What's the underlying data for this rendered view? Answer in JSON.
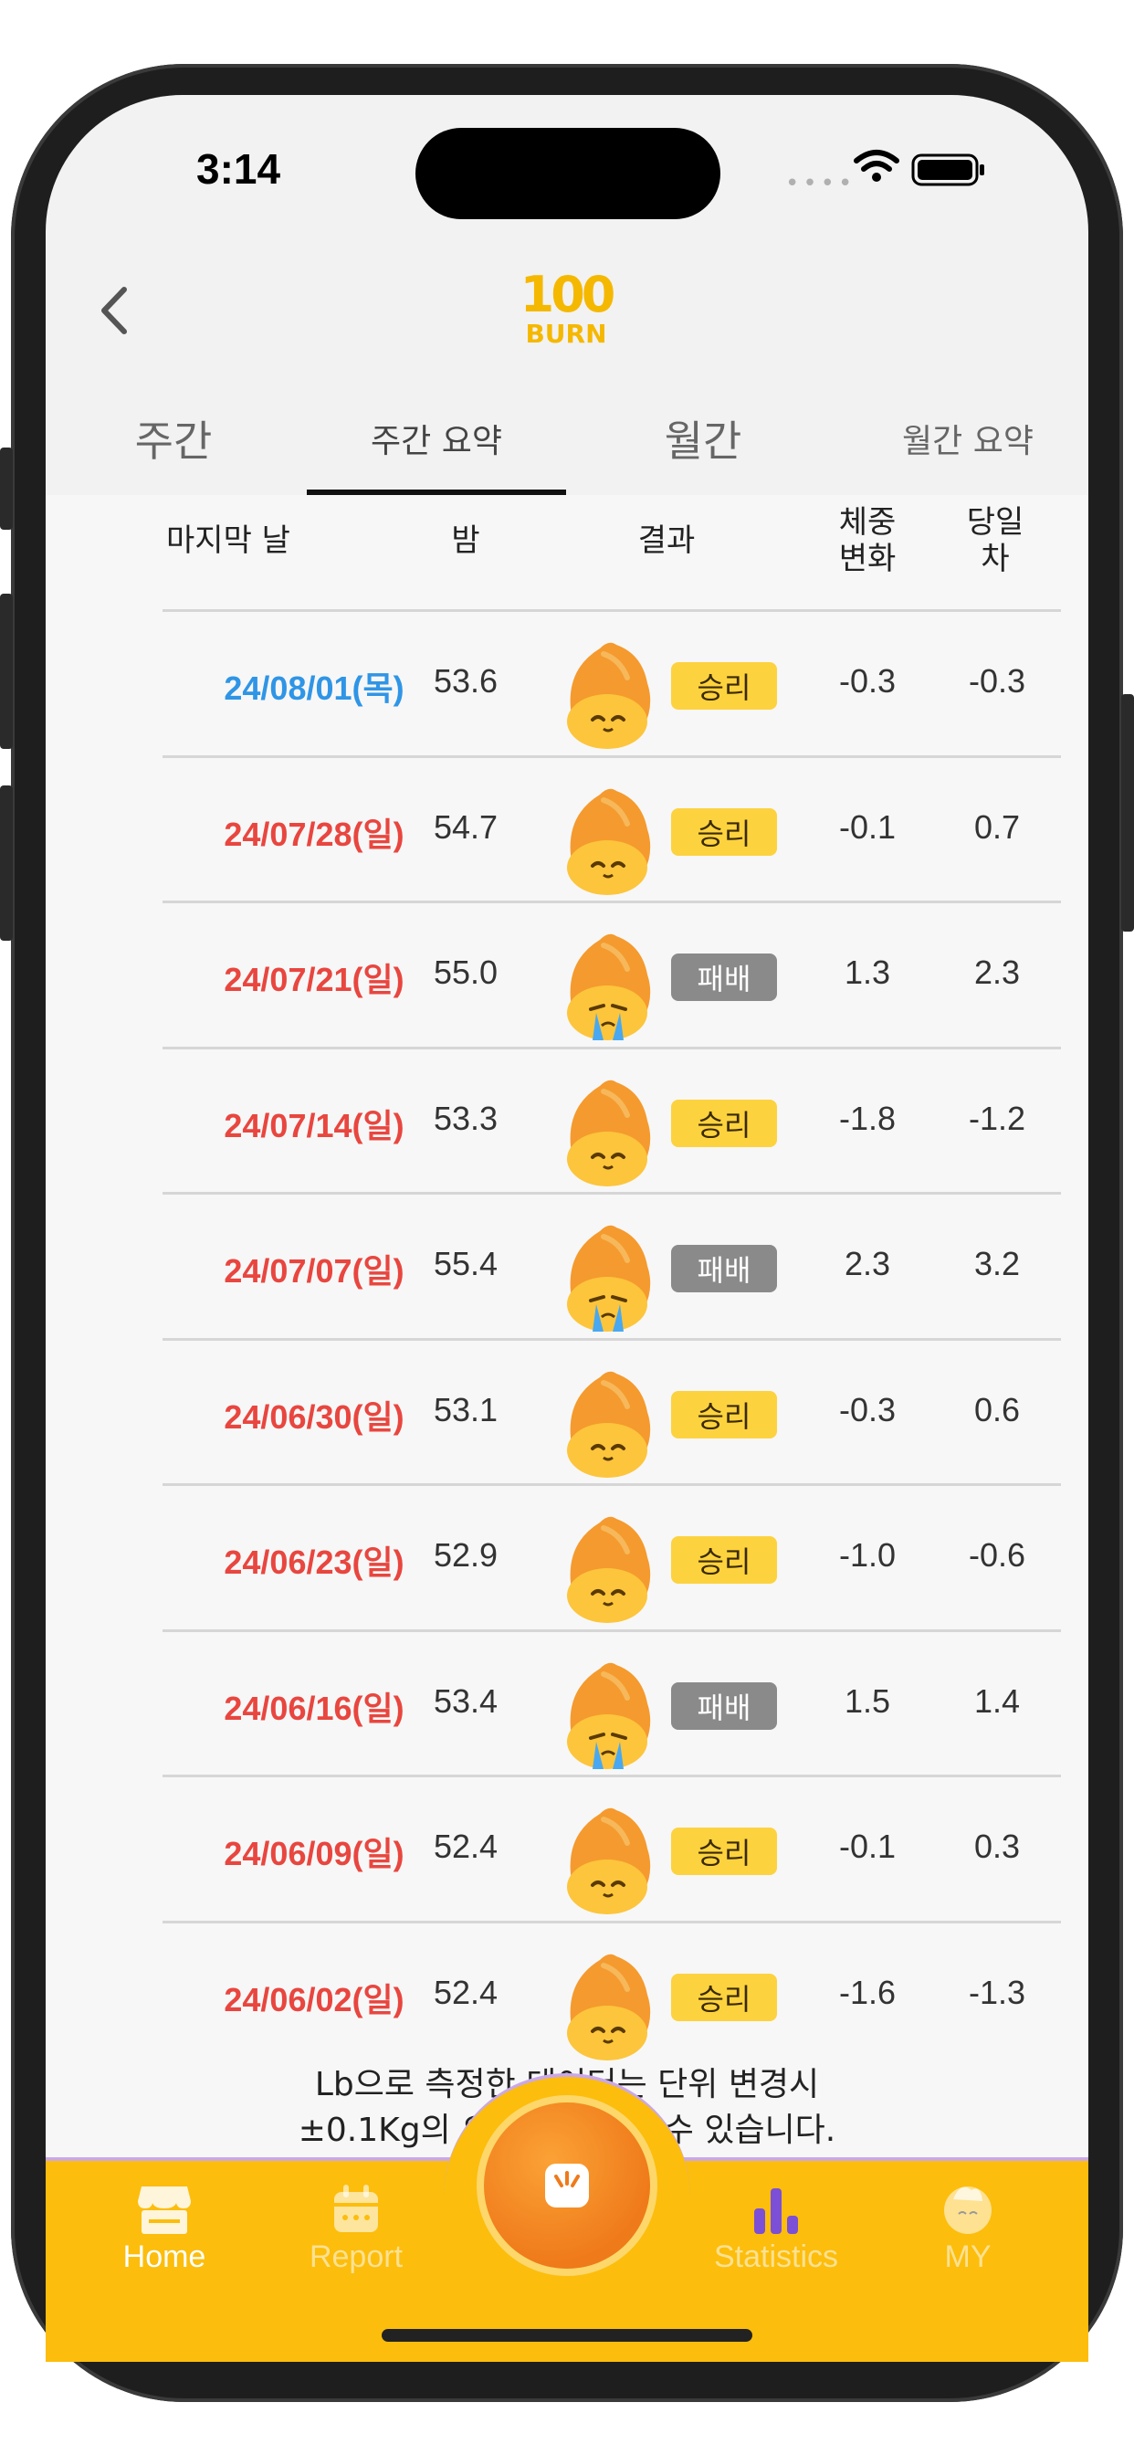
{
  "status_bar": {
    "time": "3:14",
    "dots": "••••"
  },
  "header": {
    "logo_number": "100",
    "logo_word": "BURN"
  },
  "tabs": [
    {
      "label": "주간",
      "active": false
    },
    {
      "label": "주간 요약",
      "active": true
    },
    {
      "label": "월간",
      "active": false
    },
    {
      "label": "월간 요약",
      "active": false
    }
  ],
  "table": {
    "headers": {
      "last_day": "마지막 날",
      "bam": "밤",
      "result": "결과",
      "weight_change_1": "체중",
      "weight_change_2": "변화",
      "day_diff_1": "당일",
      "day_diff_2": "차"
    },
    "rows": [
      {
        "date": "24/08/01(목)",
        "bam": "53.6",
        "result": "승리",
        "win": true,
        "change": "-0.3",
        "diff": "-0.3",
        "color": "#2f95e6"
      },
      {
        "date": "24/07/28(일)",
        "bam": "54.7",
        "result": "승리",
        "win": true,
        "change": "-0.1",
        "diff": "0.7",
        "color": "#e8463f"
      },
      {
        "date": "24/07/21(일)",
        "bam": "55.0",
        "result": "패배",
        "win": false,
        "change": "1.3",
        "diff": "2.3",
        "color": "#e8463f"
      },
      {
        "date": "24/07/14(일)",
        "bam": "53.3",
        "result": "승리",
        "win": true,
        "change": "-1.8",
        "diff": "-1.2",
        "color": "#e8463f"
      },
      {
        "date": "24/07/07(일)",
        "bam": "55.4",
        "result": "패배",
        "win": false,
        "change": "2.3",
        "diff": "3.2",
        "color": "#e8463f"
      },
      {
        "date": "24/06/30(일)",
        "bam": "53.1",
        "result": "승리",
        "win": true,
        "change": "-0.3",
        "diff": "0.6",
        "color": "#e8463f"
      },
      {
        "date": "24/06/23(일)",
        "bam": "52.9",
        "result": "승리",
        "win": true,
        "change": "-1.0",
        "diff": "-0.6",
        "color": "#e8463f"
      },
      {
        "date": "24/06/16(일)",
        "bam": "53.4",
        "result": "패배",
        "win": false,
        "change": "1.5",
        "diff": "1.4",
        "color": "#e8463f"
      },
      {
        "date": "24/06/09(일)",
        "bam": "52.4",
        "result": "승리",
        "win": true,
        "change": "-0.1",
        "diff": "0.3",
        "color": "#e8463f"
      },
      {
        "date": "24/06/02(일)",
        "bam": "52.4",
        "result": "승리",
        "win": true,
        "change": "-1.6",
        "diff": "-1.3",
        "color": "#e8463f"
      }
    ]
  },
  "footnote": {
    "line1": "Lb으로 측정한 데이터는 단위 변경시",
    "line2": "±0.1Kg의 오차가 발생할 수 있습니다."
  },
  "tab_bar": {
    "home": "Home",
    "report": "Report",
    "statistics": "Statistics",
    "my": "MY"
  },
  "colors": {
    "accent": "#fcbd0c",
    "date_blue": "#2f95e6",
    "date_red": "#e8463f",
    "win_badge": "#fdd23f",
    "lose_badge": "#8a8a8a"
  }
}
